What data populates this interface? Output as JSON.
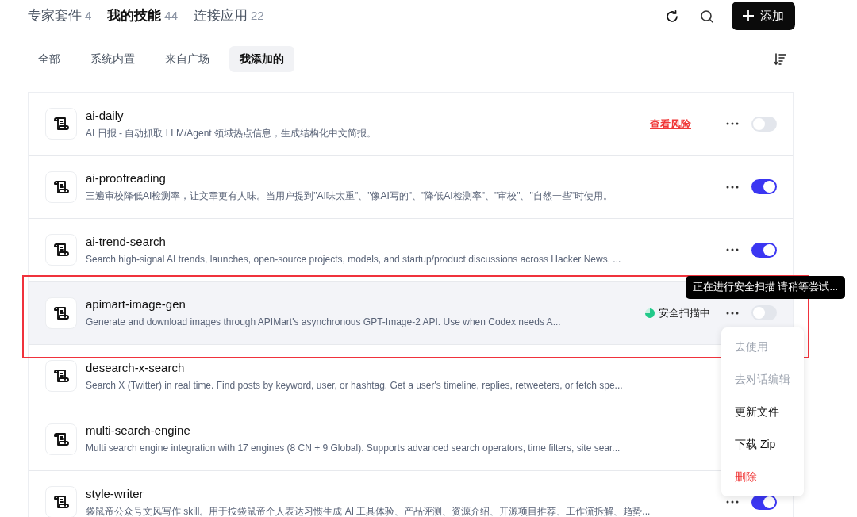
{
  "top_tabs": [
    {
      "label": "专家套件",
      "count": "4",
      "selected": false
    },
    {
      "label": "我的技能",
      "count": "44",
      "selected": true
    },
    {
      "label": "连接应用",
      "count": "22",
      "selected": false
    }
  ],
  "add_button": {
    "label": "添加"
  },
  "filters": [
    {
      "label": "全部",
      "selected": false
    },
    {
      "label": "系统内置",
      "selected": false
    },
    {
      "label": "来自广场",
      "selected": false
    },
    {
      "label": "我添加的",
      "selected": true
    }
  ],
  "skills": [
    {
      "name": "ai-daily",
      "description": "AI 日报 - 自动抓取 LLM/Agent 领域热点信息，生成结构化中文简报。",
      "status": {
        "kind": "risk",
        "label": "查看风险"
      },
      "toggle": {
        "on": false
      },
      "highlighted": false
    },
    {
      "name": "ai-proofreading",
      "description": "三遍审校降低AI检测率，让文章更有人味。当用户提到\"AI味太重\"、\"像AI写的\"、\"降低AI检测率\"、\"审校\"、\"自然一些\"时使用。",
      "toggle": {
        "on": true
      },
      "highlighted": false
    },
    {
      "name": "ai-trend-search",
      "description": "Search high-signal AI trends, launches, open-source projects, models, and startup/product discussions across Hacker News, ...",
      "toggle": {
        "on": true
      },
      "highlighted": false
    },
    {
      "name": "apimart-image-gen",
      "description": "Generate and download images through APIMart's asynchronous GPT-Image-2 API. Use when Codex needs A...",
      "status": {
        "kind": "scanning",
        "label": "安全扫描中"
      },
      "toggle": {
        "on": false
      },
      "highlighted": true
    },
    {
      "name": "desearch-x-search",
      "description": "Search X (Twitter) in real time. Find posts by keyword, user, or hashtag. Get a user's timeline, replies, retweeters, or fetch spe...",
      "highlighted": false
    },
    {
      "name": "multi-search-engine",
      "description": "Multi search engine integration with 17 engines (8 CN + 9 Global). Supports advanced search operators, time filters, site sear...",
      "highlighted": false
    },
    {
      "name": "style-writer",
      "description": "袋鼠帝公众号文风写作 skill。用于按袋鼠帝个人表达习惯生成 AI 工具体验、产品评测、资源介绍、开源项目推荐、工作流拆解、趋势...",
      "toggle": {
        "on": true
      },
      "highlighted": false
    }
  ],
  "tooltip": "正在进行安全扫描 请稍等尝试...",
  "context_menu": [
    {
      "label": "去使用",
      "kind": "normal",
      "disabled": true
    },
    {
      "label": "去对话编辑",
      "kind": "normal",
      "disabled": true
    },
    {
      "label": "更新文件",
      "kind": "normal",
      "disabled": false
    },
    {
      "label": "下载 Zip",
      "kind": "normal",
      "disabled": false
    },
    {
      "label": "删除",
      "kind": "danger",
      "disabled": false
    }
  ]
}
